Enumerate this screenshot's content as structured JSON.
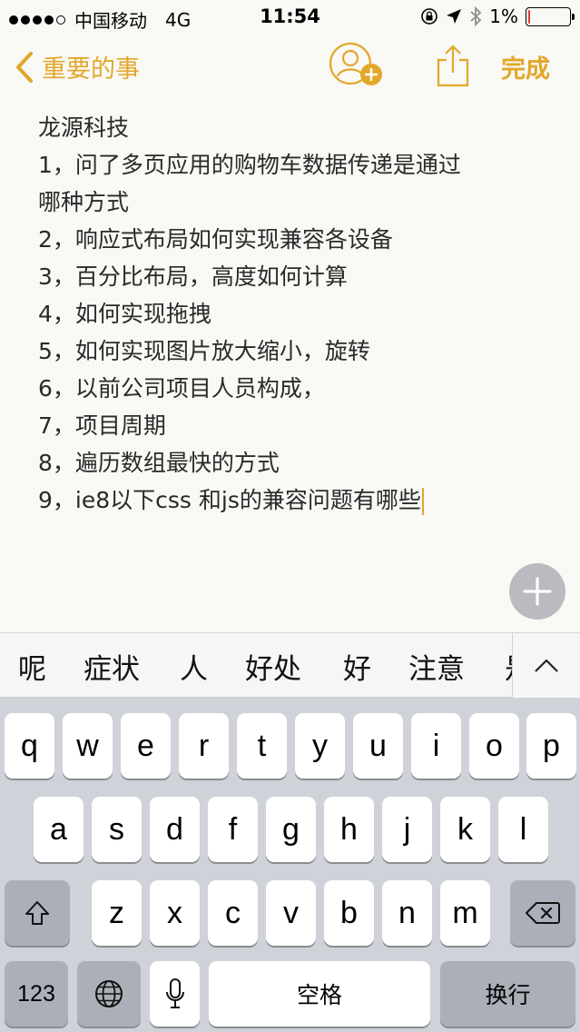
{
  "status_bar": {
    "carrier": "中国移动",
    "network": "4G",
    "time": "11:54",
    "battery": "1%",
    "icons": [
      "signal-dots",
      "lock-rotation-icon",
      "location-arrow-icon",
      "bluetooth-icon",
      "battery-icon"
    ]
  },
  "nav": {
    "back_label": "重要的事",
    "done_label": "完成",
    "accent_color": "#e2a72a"
  },
  "note": {
    "lines": [
      "龙源科技",
      "1，问了多页应用的购物车数据传递是通过",
      "哪种方式",
      "2，响应式布局如何实现兼容各设备",
      "3，百分比布局，高度如何计算",
      "4，如何实现拖拽",
      "5，如何实现图片放大缩小，旋转",
      "6，以前公司项目人员构成，",
      "7，项目周期",
      "8，遍历数组最快的方式",
      "9，ie8以下css 和js的兼容问题有哪些"
    ]
  },
  "candidates": [
    "呢",
    "症状",
    "人",
    "好处",
    "好",
    "注意",
    "是"
  ],
  "keyboard": {
    "row1": [
      "q",
      "w",
      "e",
      "r",
      "t",
      "y",
      "u",
      "i",
      "o",
      "p"
    ],
    "row2": [
      "a",
      "s",
      "d",
      "f",
      "g",
      "h",
      "j",
      "k",
      "l"
    ],
    "row3": [
      "z",
      "x",
      "c",
      "v",
      "b",
      "n",
      "m"
    ],
    "numbers_label": "123",
    "space_label": "空格",
    "return_label": "换行"
  }
}
